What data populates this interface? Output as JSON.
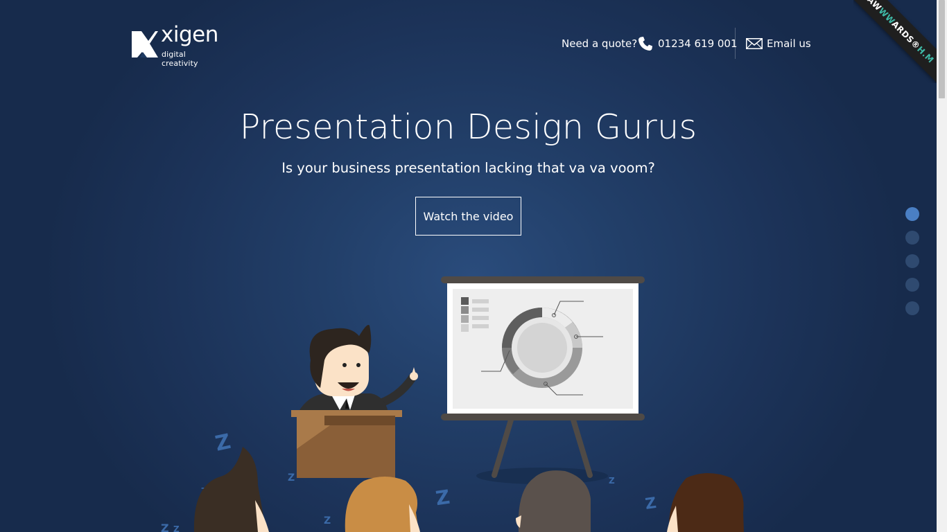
{
  "header": {
    "logo_name": "xigen",
    "logo_tagline": "digital creativity",
    "quote_label": "Need a quote?",
    "phone_number": "01234 619 001",
    "email_label": "Email us"
  },
  "ribbon": {
    "text_main": "AW",
    "text_accent": "WW",
    "text_end": "ARDS",
    "text_extra": "®",
    "text_tail": "H.M"
  },
  "hero": {
    "title": "Presentation Design Gurus",
    "subtitle": "Is your business presentation lacking that va va voom?",
    "cta_label": "Watch the video"
  },
  "side_nav": {
    "dots": [
      {
        "active": true
      },
      {
        "active": false
      },
      {
        "active": false
      },
      {
        "active": false
      },
      {
        "active": false
      }
    ]
  },
  "colors": {
    "background": "#1c3359",
    "dot_active": "#4a7fc4",
    "dot_inactive": "#2f4a70",
    "ribbon_accent": "#3fb9a7"
  }
}
